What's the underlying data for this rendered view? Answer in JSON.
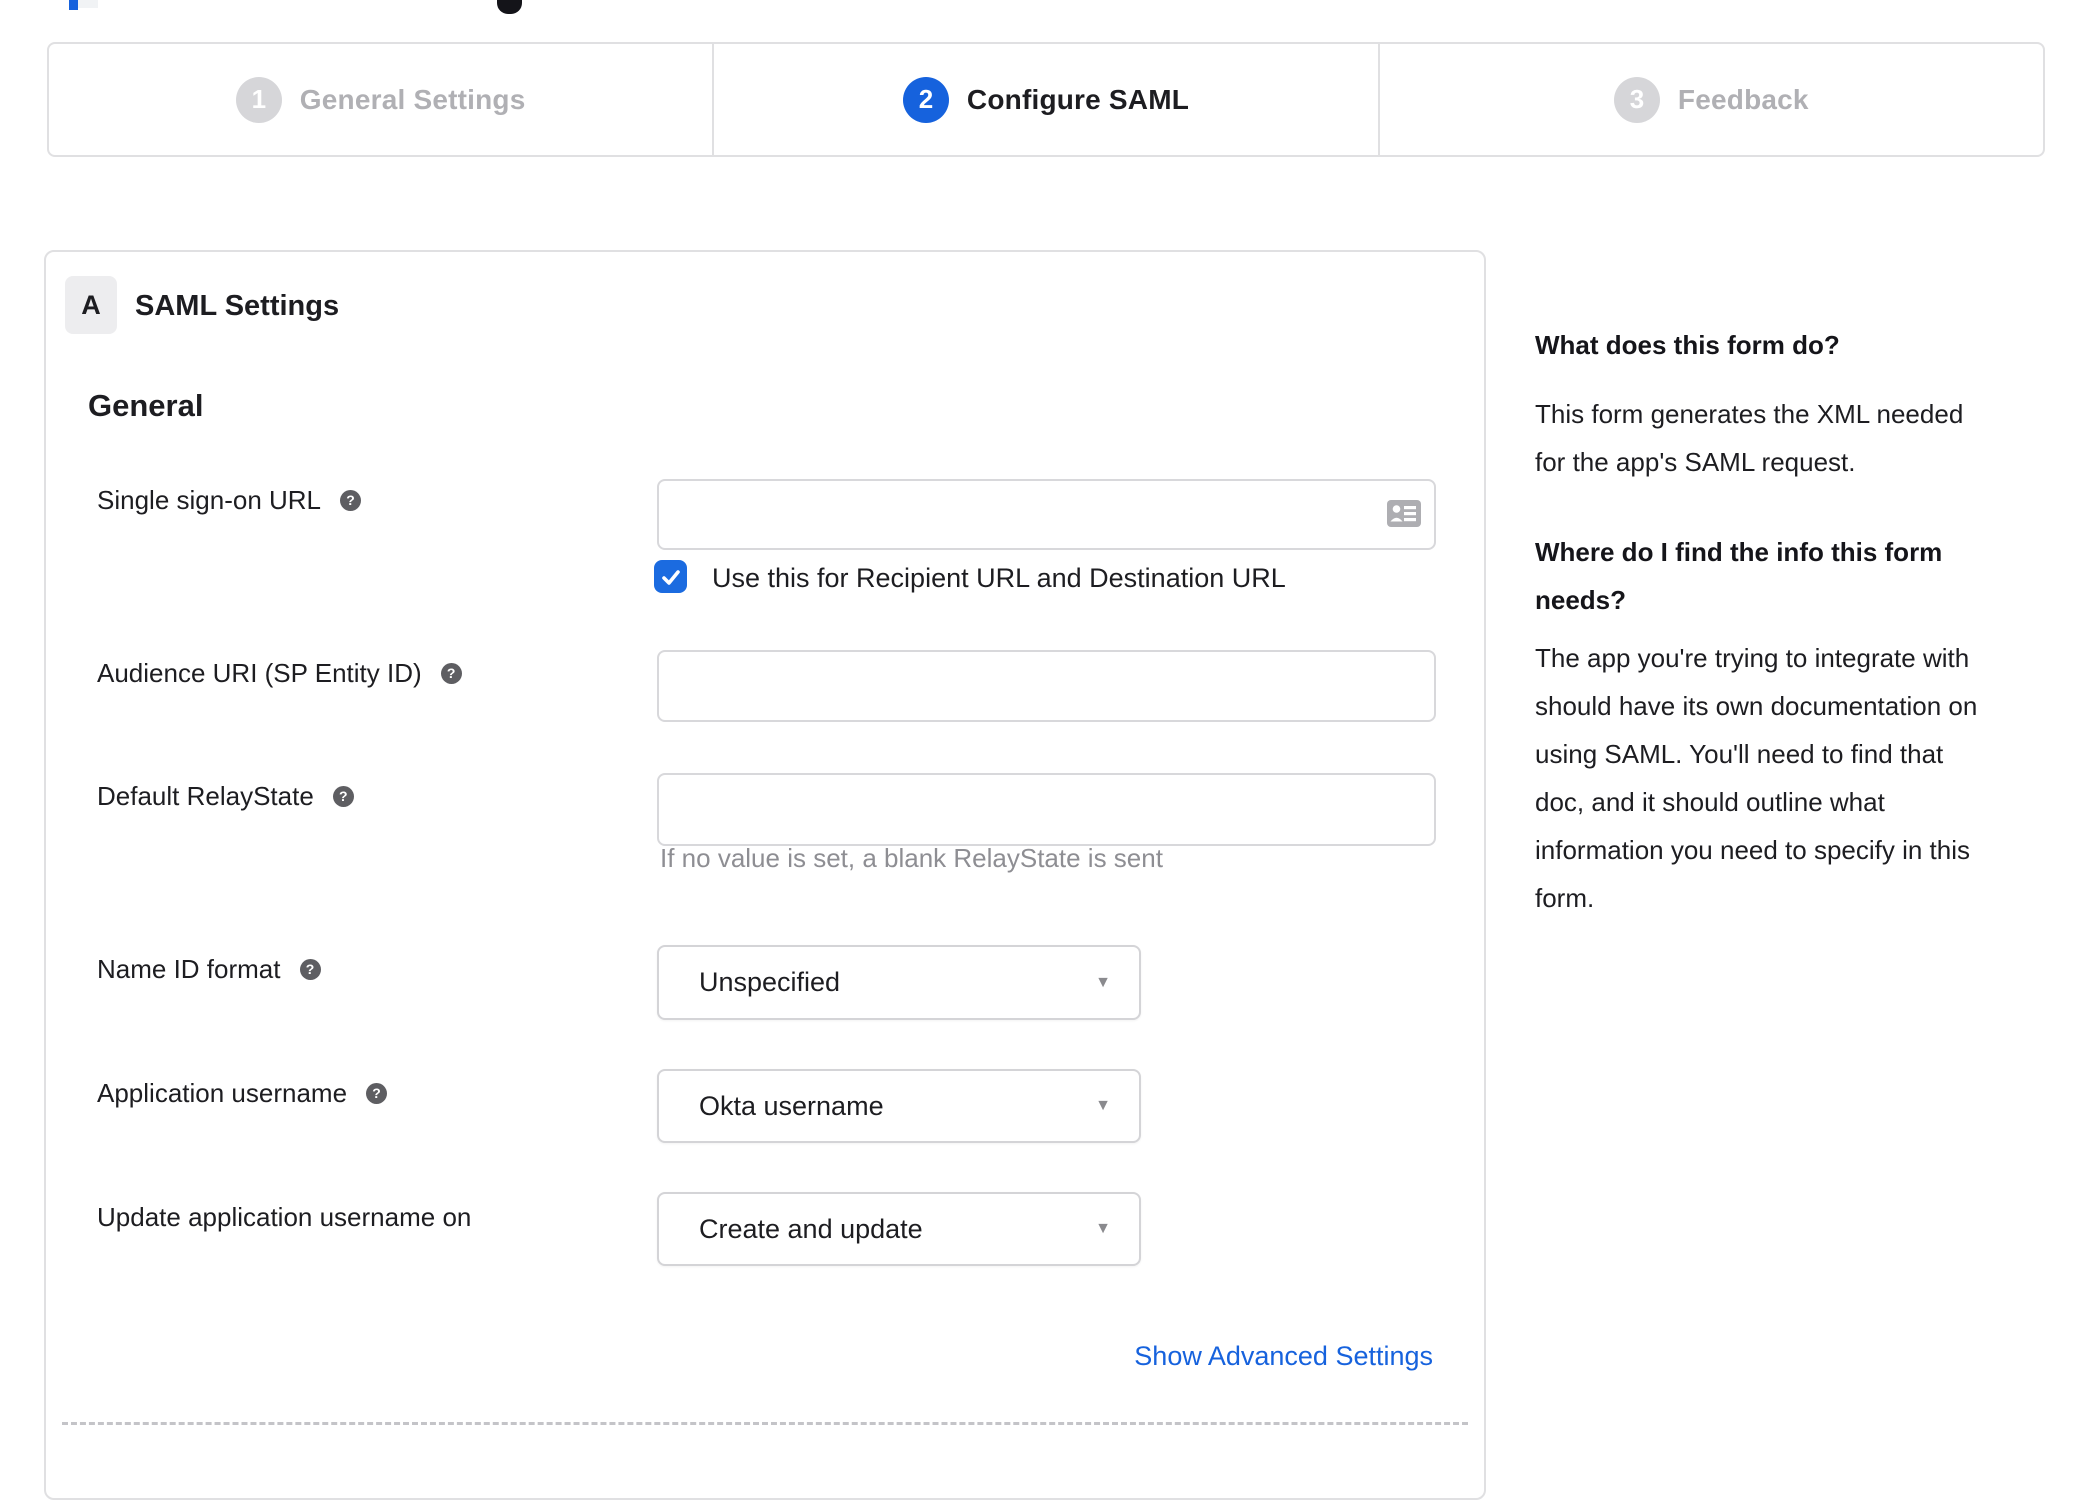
{
  "colors": {
    "accent_blue": "#1662dd",
    "checkbox_blue": "#1b6be0",
    "inactive_step_gray": "#d6d6d9",
    "inactive_label_gray": "#b0b0b4",
    "border_gray": "#e0e0e2",
    "hint_gray": "#8e8e93",
    "help_icon_gray": "#5e5e62"
  },
  "icons": {
    "help_glyph": "?",
    "caret_glyph": "▼",
    "sso_input_icon": "contact-card",
    "checkbox_icon": "checkmark"
  },
  "stepper": {
    "steps": [
      {
        "number": "1",
        "label": "General Settings",
        "state": "inactive"
      },
      {
        "number": "2",
        "label": "Configure SAML",
        "state": "active"
      },
      {
        "number": "3",
        "label": "Feedback",
        "state": "inactive"
      }
    ]
  },
  "form": {
    "section_label": "A",
    "section_title": "SAML Settings",
    "heading": "General",
    "sso": {
      "label": "Single sign-on URL",
      "value": "",
      "checkbox_label": "Use this for Recipient URL and Destination URL",
      "checked": true
    },
    "audience": {
      "label": "Audience URI (SP Entity ID)",
      "value": ""
    },
    "relay_state": {
      "label": "Default RelayState",
      "value": "",
      "hint": "If no value is set, a blank RelayState is sent"
    },
    "name_id": {
      "label": "Name ID format",
      "value": "Unspecified"
    },
    "app_username": {
      "label": "Application username",
      "value": "Okta username"
    },
    "update_username": {
      "label": "Update application username on",
      "value": "Create and update"
    },
    "advanced_link": "Show Advanced Settings"
  },
  "sidebar": {
    "heading1": "What does this form do?",
    "body1": "This form generates the XML needed\nfor the app's SAML request.",
    "heading2": "Where do I find the info this form\nneeds?",
    "body2": "The app you're trying to integrate with\nshould have its own documentation on\nusing SAML. You'll need to find that\ndoc, and it should outline what\ninformation you need to specify in this\nform."
  }
}
